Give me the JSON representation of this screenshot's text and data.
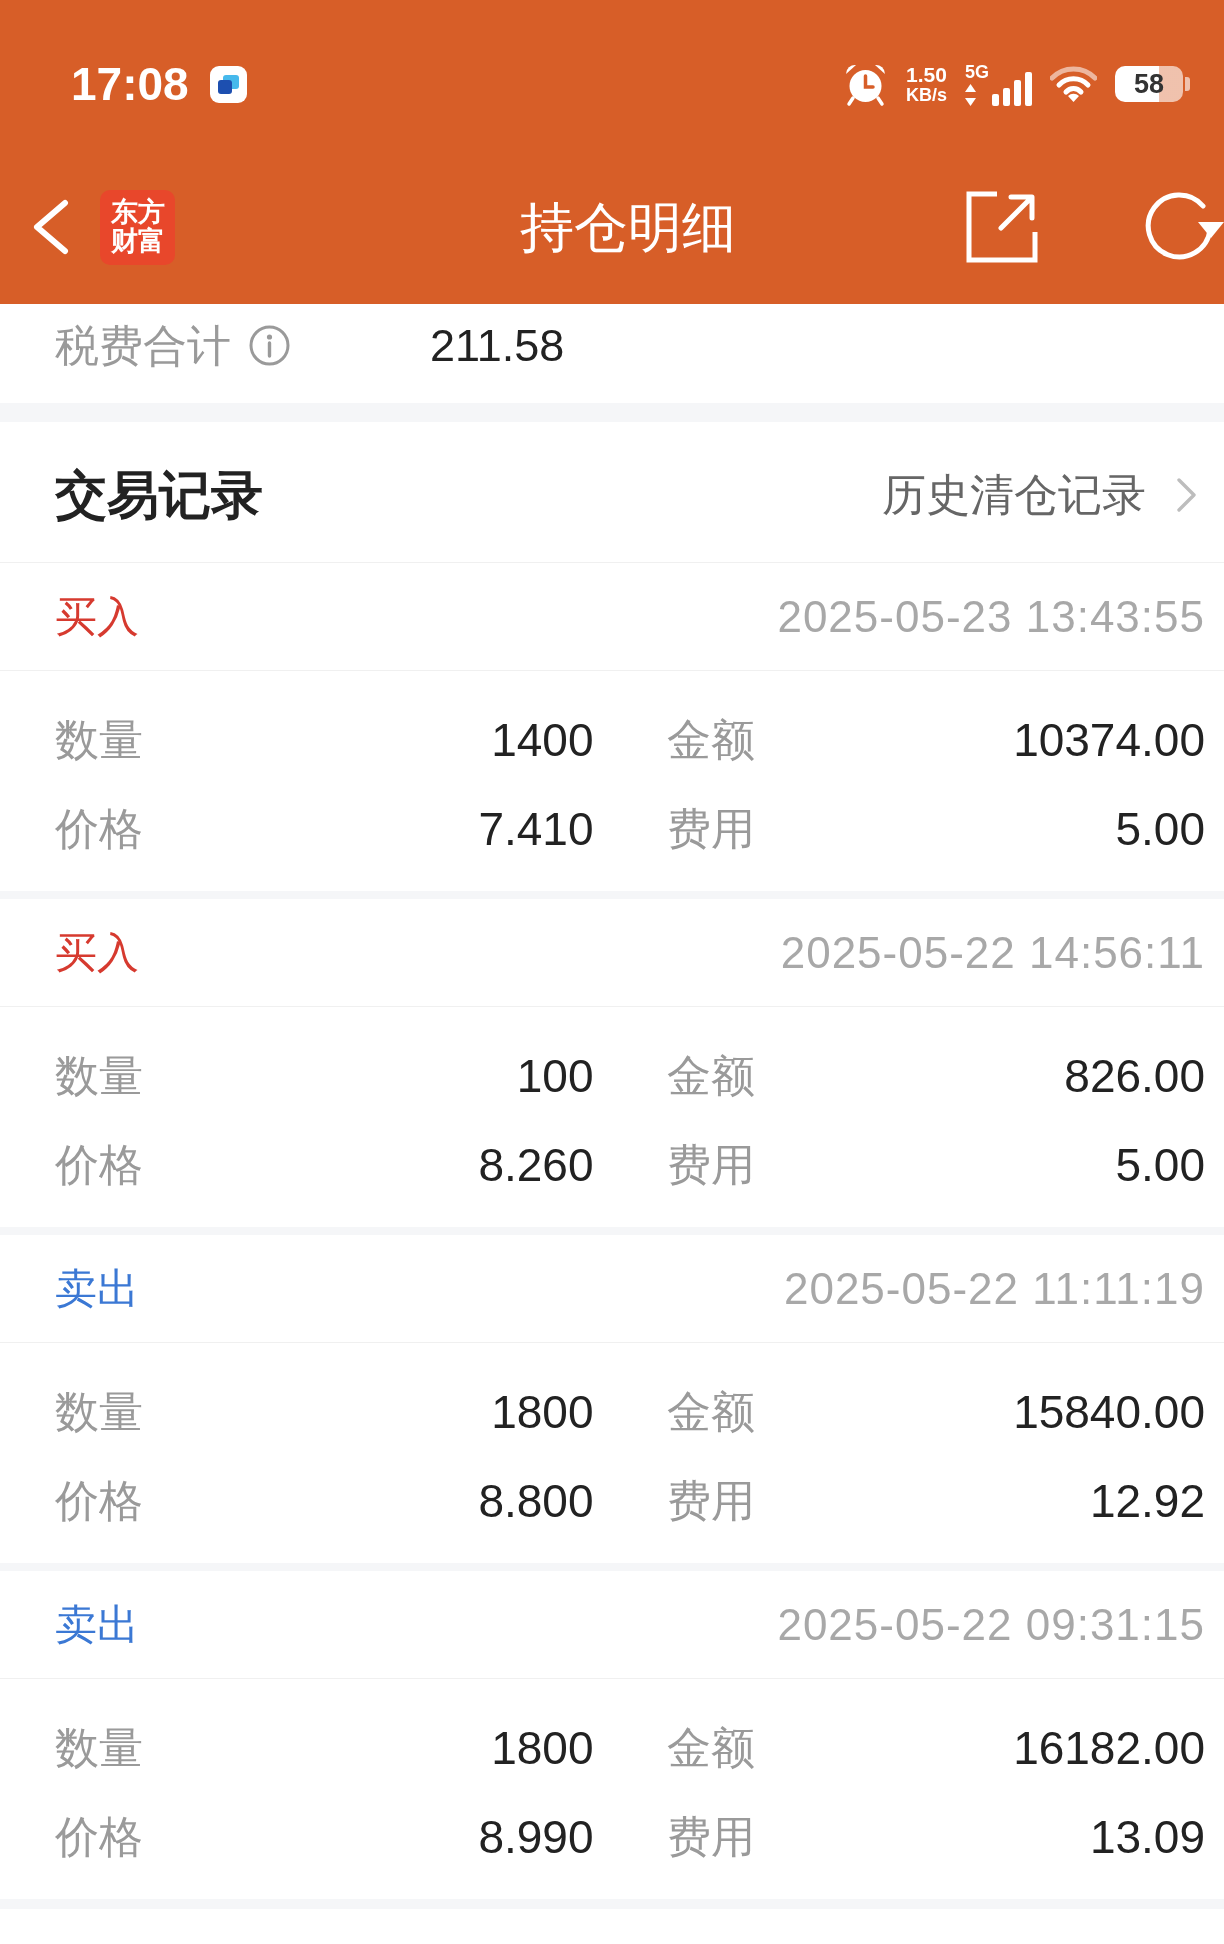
{
  "status_bar": {
    "time": "17:08",
    "network_speed": {
      "value": "1.50",
      "unit": "KB/s"
    },
    "network_type": "5G",
    "battery": "58"
  },
  "header": {
    "logo_lines": [
      "东方",
      "财富"
    ],
    "title": "持仓明细"
  },
  "summary": {
    "label": "税费合计",
    "value": "211.58"
  },
  "trade_records": {
    "title": "交易记录",
    "history_link": "历史清仓记录",
    "records": [
      {
        "side": "买入",
        "kind": "buy",
        "time": "2025-05-23 13:43:55",
        "fields": [
          {
            "label": "数量",
            "value": "1400"
          },
          {
            "label": "金额",
            "value": "10374.00"
          },
          {
            "label": "价格",
            "value": "7.410"
          },
          {
            "label": "费用",
            "value": "5.00"
          }
        ]
      },
      {
        "side": "买入",
        "kind": "buy",
        "time": "2025-05-22 14:56:11",
        "fields": [
          {
            "label": "数量",
            "value": "100"
          },
          {
            "label": "金额",
            "value": "826.00"
          },
          {
            "label": "价格",
            "value": "8.260"
          },
          {
            "label": "费用",
            "value": "5.00"
          }
        ]
      },
      {
        "side": "卖出",
        "kind": "sell",
        "time": "2025-05-22 11:11:19",
        "fields": [
          {
            "label": "数量",
            "value": "1800"
          },
          {
            "label": "金额",
            "value": "15840.00"
          },
          {
            "label": "价格",
            "value": "8.800"
          },
          {
            "label": "费用",
            "value": "12.92"
          }
        ]
      },
      {
        "side": "卖出",
        "kind": "sell",
        "time": "2025-05-22 09:31:15",
        "fields": [
          {
            "label": "数量",
            "value": "1800"
          },
          {
            "label": "金额",
            "value": "16182.00"
          },
          {
            "label": "价格",
            "value": "8.990"
          },
          {
            "label": "费用",
            "value": "13.09"
          }
        ]
      }
    ]
  }
}
